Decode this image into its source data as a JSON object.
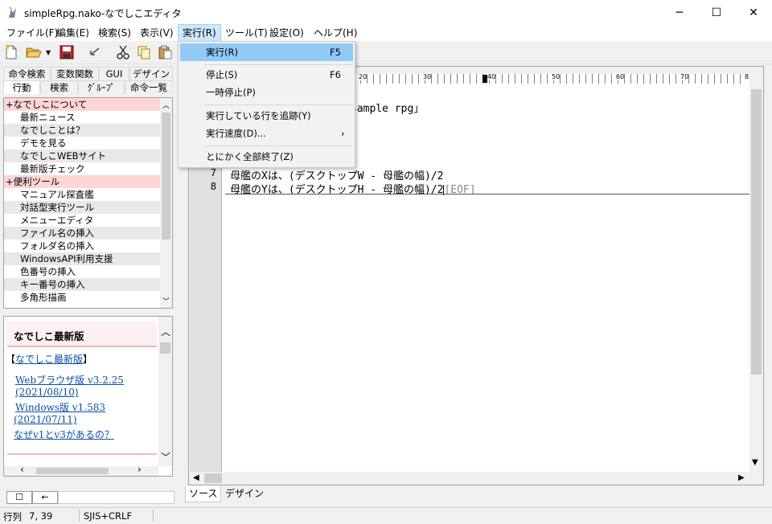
{
  "window": {
    "title": "simpleRpg.nako-なでしこエディタ",
    "minimize": "─",
    "maximize": "☐",
    "close": "✕"
  },
  "menubar": [
    "ファイル(F)",
    "編集(E)",
    "検索(S)",
    "表示(V)",
    "実行(R)",
    "ツール(T)",
    "設定(O)",
    "ヘルプ(H)"
  ],
  "run_menu": [
    {
      "label": "実行(R)",
      "shortcut": "F5"
    },
    {
      "label": "停止(S)",
      "shortcut": "F6"
    },
    {
      "label": "一時停止(P)",
      "shortcut": ""
    },
    {
      "label": "実行している行を追跡(Y)",
      "shortcut": ""
    },
    {
      "label": "実行速度(D)...",
      "shortcut": "›"
    },
    {
      "label": "とにかく全部終了(Z)",
      "shortcut": ""
    }
  ],
  "left_tabs_row1": [
    "命令検索",
    "変数関数",
    "GUI",
    "デザイン"
  ],
  "left_tabs_row2": [
    "行動",
    "検索",
    "ｸﾞﾙｰﾌﾟ",
    "命令一覧"
  ],
  "tree": [
    {
      "label": "+なでしこについて",
      "type": "cat"
    },
    {
      "label": "最新ニュース",
      "type": "child"
    },
    {
      "label": "なでしことは？",
      "type": "child"
    },
    {
      "label": "デモを見る",
      "type": "child"
    },
    {
      "label": "なでしこWEBサイト",
      "type": "child"
    },
    {
      "label": "最新版チェック",
      "type": "child"
    },
    {
      "label": "+便利ツール",
      "type": "cat"
    },
    {
      "label": "マニュアル探査艦",
      "type": "child"
    },
    {
      "label": "対話型実行ツール",
      "type": "child"
    },
    {
      "label": "メニューエディタ",
      "type": "child"
    },
    {
      "label": "ファイル名の挿入",
      "type": "child"
    },
    {
      "label": "フォルダ名の挿入",
      "type": "child"
    },
    {
      "label": "WindowsAPI利用支援",
      "type": "child"
    },
    {
      "label": "色番号の挿入",
      "type": "child"
    },
    {
      "label": "キー番号の挿入",
      "type": "child"
    },
    {
      "label": "多角形描画",
      "type": "child"
    }
  ],
  "news": {
    "heading": "なでしこ最新版",
    "bracket_open": "【",
    "bracket_link": "なでしこ最新版",
    "bracket_close": "】",
    "links": [
      "Webブラウザ版 v3.2.25",
      "(2021/08/10)",
      "Windows版 v1.583",
      "(2021/07/11)",
      "なぜv1とv3があるの？"
    ]
  },
  "left_bottom": {
    "btn1": "☐",
    "btn2": "←"
  },
  "editor": {
    "ruler_labels": [
      "20",
      "30",
      "40",
      "50",
      "60",
      "70",
      "8"
    ],
    "visible_fragment": "sample rpg」",
    "lines": [
      {
        "num": "7",
        "text": "母艦のXは、(デスクトップW - 母艦の幅)/2",
        "eof": ""
      },
      {
        "num": "8",
        "text": "母艦のYは、(デスクトップH - 母艦の幅)/2",
        "eof": "[EOF]"
      }
    ]
  },
  "bottom_tabs": [
    "ソース",
    "デザイン"
  ],
  "status": {
    "pos_label": "行列",
    "pos_value": "7, 39",
    "encoding": "SJIS+CRLF"
  }
}
